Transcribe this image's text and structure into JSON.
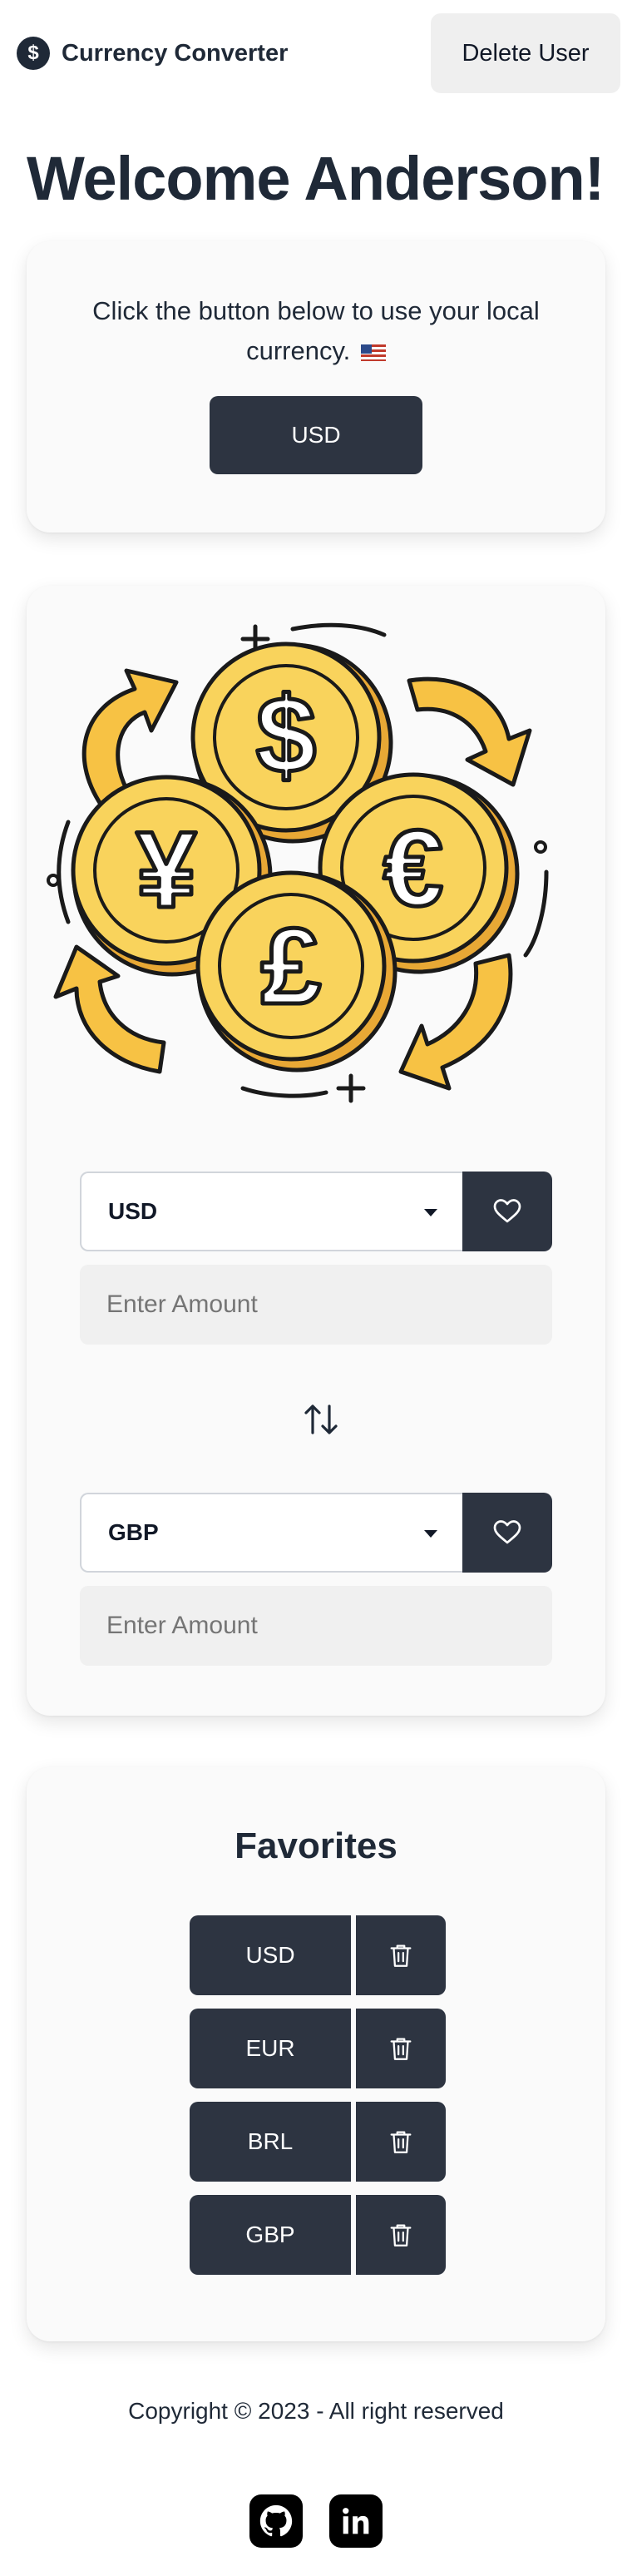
{
  "header": {
    "brand_name": "Currency Converter",
    "brand_icon": "$",
    "delete_label": "Delete User"
  },
  "welcome": "Welcome Anderson!",
  "local_currency": {
    "text": "Click the button below to use your local currency.",
    "flag_icon": "us-flag",
    "button_label": "USD"
  },
  "converter": {
    "from": {
      "currency": "USD",
      "amount_placeholder": "Enter Amount"
    },
    "to": {
      "currency": "GBP",
      "amount_placeholder": "Enter Amount"
    },
    "swap_icon": "swap-vertical-icon"
  },
  "favorites": {
    "title": "Favorites",
    "items": [
      {
        "label": "USD"
      },
      {
        "label": "EUR"
      },
      {
        "label": "BRL"
      },
      {
        "label": "GBP"
      }
    ]
  },
  "footer": {
    "copyright": "Copyright © 2023 - All right reserved",
    "social_icons": [
      "github-icon",
      "linkedin-icon"
    ],
    "linkedin_text": "in"
  },
  "colors": {
    "primary_dark": "#2d3441",
    "coin": "#f9d35c",
    "arrow": "#f7c244"
  }
}
